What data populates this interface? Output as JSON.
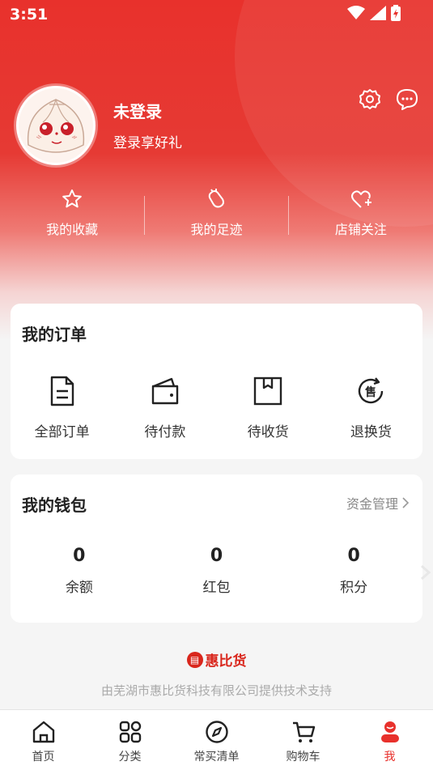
{
  "status_bar": {
    "time": "3:51"
  },
  "profile": {
    "name": "未登录",
    "login_tip": "登录享好礼"
  },
  "quick_links": [
    {
      "label": "我的收藏",
      "icon": "star-icon"
    },
    {
      "label": "我的足迹",
      "icon": "footprint-icon"
    },
    {
      "label": "店铺关注",
      "icon": "heart-plus-icon"
    }
  ],
  "orders": {
    "title": "我的订单",
    "items": [
      {
        "label": "全部订单",
        "icon": "document-icon"
      },
      {
        "label": "待付款",
        "icon": "wallet-icon"
      },
      {
        "label": "待收货",
        "icon": "box-icon"
      },
      {
        "label": "退换货",
        "icon": "return-icon"
      }
    ]
  },
  "wallet": {
    "title": "我的钱包",
    "manage_link": "资金管理",
    "items": [
      {
        "value": "0",
        "label": "余额"
      },
      {
        "value": "0",
        "label": "红包"
      },
      {
        "value": "0",
        "label": "积分"
      }
    ]
  },
  "footer": {
    "brand": "惠比货",
    "support": "由芜湖市惠比货科技有限公司提供技术支持"
  },
  "tabs": [
    {
      "label": "首页",
      "icon": "home-icon"
    },
    {
      "label": "分类",
      "icon": "category-grid-icon"
    },
    {
      "label": "常买清单",
      "icon": "compass-icon"
    },
    {
      "label": "购物车",
      "icon": "cart-icon"
    },
    {
      "label": "我",
      "icon": "profile-icon"
    }
  ],
  "colors": {
    "brand_red": "#e8312c",
    "active_tab": "#e8312c"
  }
}
